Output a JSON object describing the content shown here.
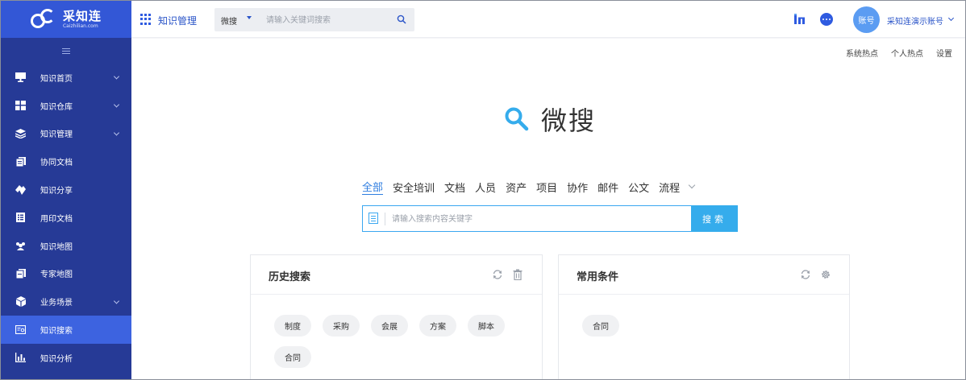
{
  "app": {
    "logo_name": "采知连",
    "logo_sub": "Caizhilian.com",
    "module_title": "知识管理"
  },
  "sidebar": {
    "items": [
      {
        "label": "知识首页",
        "icon": "monitor-icon",
        "has_children": true
      },
      {
        "label": "知识仓库",
        "icon": "grid-icon",
        "has_children": true
      },
      {
        "label": "知识管理",
        "icon": "layers-icon",
        "has_children": true
      },
      {
        "label": "协同文档",
        "icon": "doc-copy-icon",
        "has_children": false
      },
      {
        "label": "知识分享",
        "icon": "share-icon",
        "has_children": false
      },
      {
        "label": "用印文档",
        "icon": "stamp-doc-icon",
        "has_children": false
      },
      {
        "label": "知识地图",
        "icon": "people-map-icon",
        "has_children": false
      },
      {
        "label": "专家地图",
        "icon": "expert-map-icon",
        "has_children": false
      },
      {
        "label": "业务场景",
        "icon": "cube-icon",
        "has_children": true
      },
      {
        "label": "知识搜索",
        "icon": "search-doc-icon",
        "has_children": false,
        "active": true
      },
      {
        "label": "知识分析",
        "icon": "bar-chart-icon",
        "has_children": false
      }
    ]
  },
  "topbar": {
    "search_type": "微搜",
    "search_placeholder": "请输入关键词搜索",
    "avatar_text": "账号",
    "account_name": "采知连演示账号",
    "accent": "#2f5be0"
  },
  "subbar": {
    "links": [
      "系统热点",
      "个人热点",
      "设置"
    ]
  },
  "main": {
    "title": "微搜",
    "categories": [
      "全部",
      "安全培训",
      "文档",
      "人员",
      "资产",
      "项目",
      "协作",
      "邮件",
      "公文",
      "流程"
    ],
    "active_category": "全部",
    "search_placeholder": "请输入搜索内容关键字",
    "search_button": "搜索"
  },
  "history": {
    "title": "历史搜索",
    "tags": [
      "制度",
      "采购",
      "会展",
      "方案",
      "脚本",
      "合同"
    ]
  },
  "common": {
    "title": "常用条件",
    "tags": [
      "合同"
    ]
  }
}
